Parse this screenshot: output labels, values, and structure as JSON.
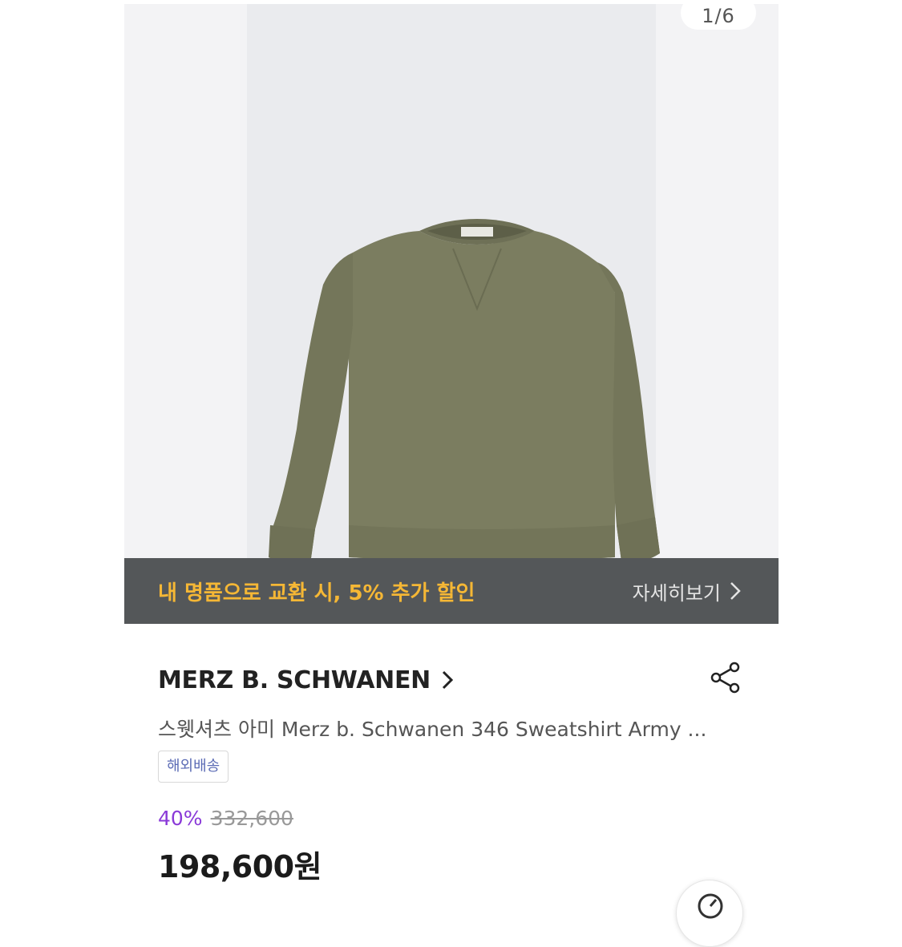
{
  "gallery": {
    "counter": "1/6",
    "image_alt": "olive green crewneck sweatshirt",
    "sweatshirt_color": "#7b7d60"
  },
  "promo": {
    "text": "내 명품으로 교환 시, 5% 추가 할인",
    "link_label": "자세히보기",
    "link_icon": "chevron-right-icon"
  },
  "product": {
    "brand": "MERZ B. SCHWANEN",
    "brand_icon": "chevron-right-icon",
    "share_icon": "share-icon",
    "title": "스웻셔츠 아미 Merz b. Schwanen 346 Sweatshirt Army ...",
    "badge": "해외배송",
    "discount_rate": "40%",
    "original_price": "332,600",
    "sale_price": "198,600원"
  },
  "colors": {
    "promo_text": "#f5b735",
    "promo_bar": "#545759",
    "discount": "#8a3ad8",
    "badge_text": "#5b6bb5"
  }
}
